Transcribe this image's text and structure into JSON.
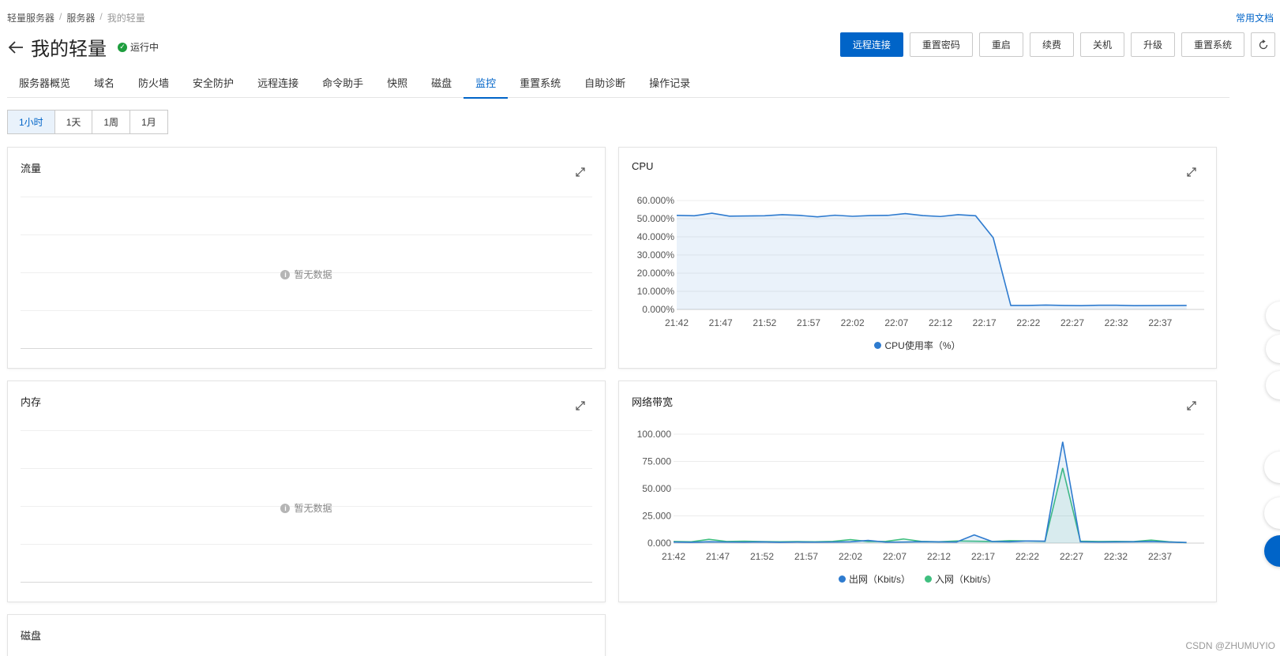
{
  "breadcrumb": [
    "轻量服务器",
    "服务器",
    "我的轻量"
  ],
  "doc_link": "常用文档",
  "header": {
    "title": "我的轻量",
    "status": "运行中"
  },
  "actions": [
    "远程连接",
    "重置密码",
    "重启",
    "续费",
    "关机",
    "升级",
    "重置系统"
  ],
  "tabs": [
    "服务器概览",
    "域名",
    "防火墙",
    "安全防护",
    "远程连接",
    "命令助手",
    "快照",
    "磁盘",
    "监控",
    "重置系统",
    "自助诊断",
    "操作记录"
  ],
  "active_tab": "监控",
  "range": [
    "1小时",
    "1天",
    "1周",
    "1月"
  ],
  "active_range": "1小时",
  "cards": {
    "traffic": {
      "title": "流量",
      "empty": "暂无数据"
    },
    "cpu": {
      "title": "CPU"
    },
    "memory": {
      "title": "内存",
      "empty": "暂无数据"
    },
    "bandwidth": {
      "title": "网络带宽"
    },
    "disk": {
      "title": "磁盘"
    }
  },
  "colors": {
    "accent": "#0064c8",
    "series_blue": "#2e7bcf",
    "series_green": "#3fbf7f",
    "status_green": "#1e9e3e"
  },
  "chart_data": [
    {
      "type": "area",
      "title": "CPU",
      "x_ticks": [
        "21:42",
        "21:47",
        "21:52",
        "21:57",
        "22:02",
        "22:07",
        "22:12",
        "22:17",
        "22:22",
        "22:27",
        "22:32",
        "22:37"
      ],
      "y_ticks": [
        "60.000%",
        "50.000%",
        "40.000%",
        "30.000%",
        "20.000%",
        "10.000%",
        "0.000%"
      ],
      "ylim": [
        0,
        60
      ],
      "x_minutes": [
        0,
        2,
        4,
        6,
        8,
        10,
        12,
        14,
        16,
        18,
        20,
        22,
        24,
        26,
        28,
        30,
        32,
        34,
        36,
        38,
        40,
        42,
        44,
        46,
        48,
        50,
        52,
        58
      ],
      "series": [
        {
          "name": "CPU使用率（%）",
          "color": "#2e7bcf",
          "values": [
            51.8,
            51.6,
            53.0,
            51.4,
            51.5,
            51.6,
            52.2,
            51.8,
            51.0,
            51.9,
            51.3,
            51.7,
            51.8,
            52.8,
            51.7,
            51.2,
            52.2,
            51.6,
            39.5,
            2.2,
            2.2,
            2.4,
            2.2,
            2.1,
            2.3,
            2.3,
            2.1,
            2.2
          ]
        }
      ],
      "legend": [
        "CPU使用率（%）"
      ],
      "grid": true
    },
    {
      "type": "area",
      "title": "网络带宽",
      "x_ticks": [
        "21:42",
        "21:47",
        "21:52",
        "21:57",
        "22:02",
        "22:07",
        "22:12",
        "22:17",
        "22:22",
        "22:27",
        "22:32",
        "22:37"
      ],
      "y_ticks": [
        "100.000",
        "75.000",
        "50.000",
        "25.000",
        "0.000"
      ],
      "ylim": [
        0,
        100
      ],
      "x_minutes": [
        0,
        2,
        4,
        6,
        8,
        10,
        12,
        14,
        16,
        18,
        20,
        22,
        24,
        26,
        28,
        30,
        32,
        34,
        36,
        38,
        40,
        42,
        44,
        46,
        48,
        50,
        52,
        54,
        56,
        58
      ],
      "series": [
        {
          "name": "出网（Kbit/s）",
          "color": "#2e7bcf",
          "values": [
            1.0,
            0.8,
            1.2,
            1.0,
            0.9,
            1.1,
            0.8,
            1.0,
            0.9,
            1.0,
            1.2,
            2.5,
            0.9,
            1.0,
            1.3,
            1.1,
            1.0,
            7.5,
            1.5,
            1.2,
            2.0,
            1.8,
            93.0,
            1.2,
            1.0,
            1.1,
            1.2,
            1.5,
            1.0,
            0.6
          ]
        },
        {
          "name": "入网（Kbit/s）",
          "color": "#3fbf7f",
          "values": [
            1.5,
            1.2,
            3.5,
            1.5,
            1.8,
            1.4,
            1.2,
            1.4,
            1.2,
            1.6,
            3.2,
            1.5,
            1.6,
            3.8,
            1.6,
            1.2,
            2.0,
            1.8,
            1.5,
            2.2,
            2.0,
            1.6,
            69.0,
            1.8,
            1.5,
            1.6,
            1.4,
            2.8,
            1.2,
            0.4
          ]
        }
      ],
      "legend": [
        "出网（Kbit/s）",
        "入网（Kbit/s）"
      ],
      "grid": true
    }
  ],
  "watermark": "CSDN @ZHUMUYIO"
}
